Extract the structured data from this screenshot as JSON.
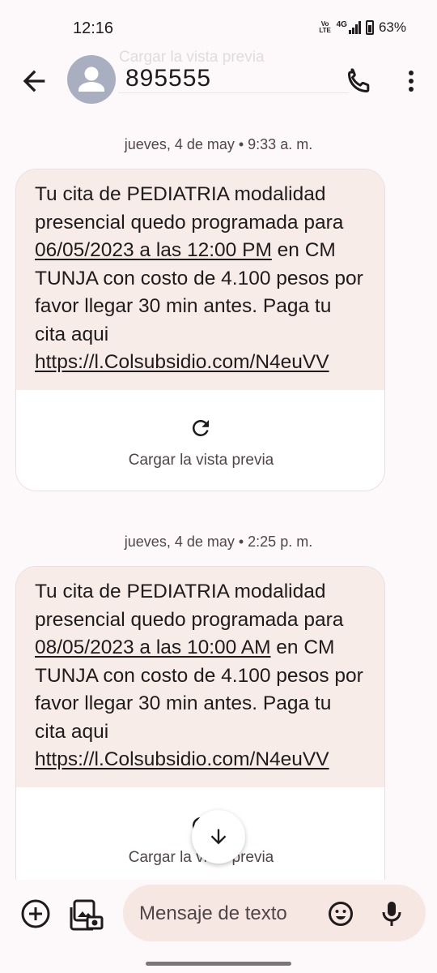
{
  "status_bar": {
    "time": "12:16",
    "volte_line1": "Vo",
    "volte_line2": "LTE",
    "network": "4G",
    "battery": "63%"
  },
  "header": {
    "ghost_text": "Cargar la vista previa",
    "contact": "895555",
    "icons": [
      "back-arrow-icon",
      "person-icon",
      "phone-icon",
      "more-vert-icon"
    ]
  },
  "messages": [
    {
      "timestamp": "jueves, 4 de may • 9:33 a. m.",
      "text_1": "Tu cita de PEDIATRIA modalidad presencial quedo programada para ",
      "date_link": "06/05/2023 a las 12:00 PM",
      "text_2": " en CM TUNJA con costo de 4.100 pesos por favor llegar 30 min antes. Paga tu cita aqui ",
      "url": "https://l.Colsubsidio.com/N4euVV",
      "preview_label": "Cargar la vista previa"
    },
    {
      "timestamp": "jueves, 4 de may • 2:25 p. m.",
      "text_1": "Tu cita de PEDIATRIA modalidad presencial quedo programada para ",
      "date_link": "08/05/2023 a las 10:00 AM",
      "text_2": " en CM TUNJA con costo de 4.100 pesos por favor llegar 30 min antes. Paga tu cita aqui ",
      "url": "https://l.Colsubsidio.com/N4euVV",
      "preview_label": "Cargar la vista previa"
    }
  ],
  "compose": {
    "placeholder": "Mensaje de texto",
    "icons": [
      "add-circle-icon",
      "gallery-icon",
      "emoji-icon",
      "mic-icon"
    ]
  },
  "colors": {
    "bubble": "#f8ece8",
    "background": "#fdf8f9",
    "avatar": "#a9afc0",
    "compose_field": "#f6e7e3"
  }
}
